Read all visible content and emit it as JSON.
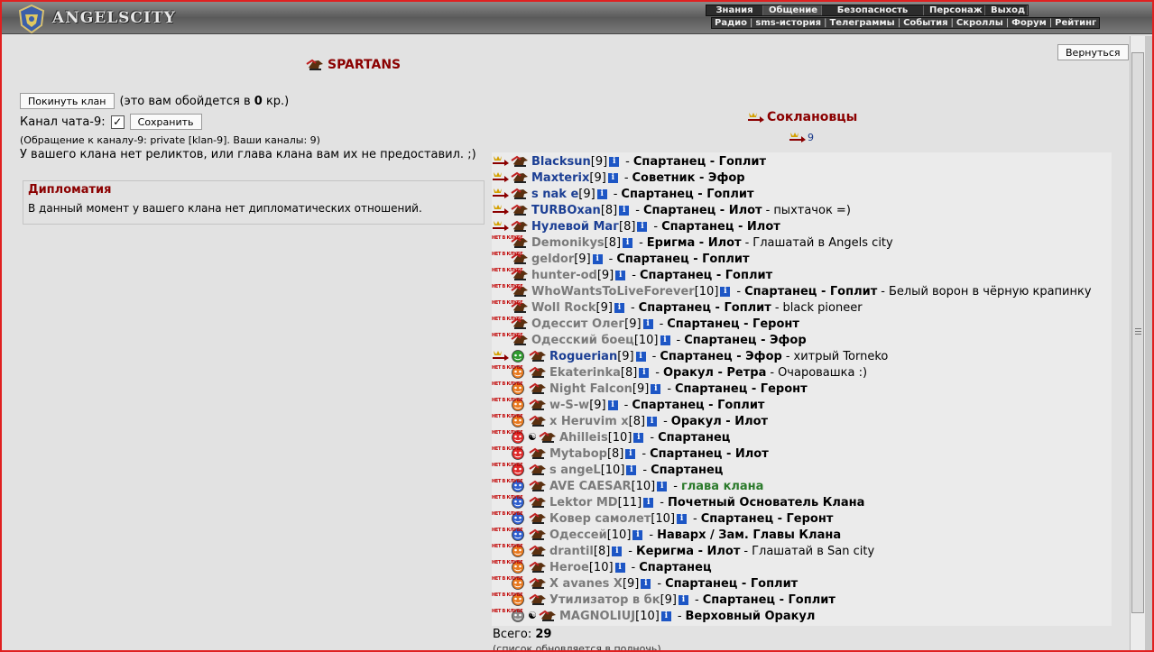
{
  "header": {
    "logo_text": "ANGELSCITY",
    "menu_top": [
      "Знания",
      "Общение",
      "Безопасность",
      "Персонаж",
      "Выход"
    ],
    "menu_top_active": "Общение",
    "menu_sub": [
      "Радио",
      "sms-история",
      "Телеграммы",
      "События",
      "Скроллы",
      "Форум",
      "Рейтинг"
    ]
  },
  "back_button": "Вернуться",
  "clan": {
    "name": "SPARTANS",
    "leave_button": "Покинуть клан",
    "leave_cost_prefix": "(это вам обойдется в ",
    "leave_cost_value": "0",
    "leave_cost_suffix": " кр.)",
    "chat_label": "Канал чата-9:",
    "chat_checked": true,
    "save_button": "Сохранить",
    "chat_note": "(Обращение к каналу-9: private [klan-9]. Ваши каналы: 9)",
    "relic_note": "У вашего клана нет реликтов, или глава клана вам их не предоставил. ;)"
  },
  "diplomacy": {
    "title": "Дипломатия",
    "text": "В данный момент у вашего клана нет дипломатических отношений."
  },
  "members": {
    "title": "Соклановцы",
    "online_count": "9",
    "offline_label": "НЕТ В КЛУБЕ",
    "rows": [
      {
        "online": true,
        "face": null,
        "yinyang": false,
        "indent": false,
        "nick": "Blacksun",
        "lvl": "[9]",
        "role": "Спартанец - Гоплит",
        "note": ""
      },
      {
        "online": true,
        "face": null,
        "yinyang": false,
        "indent": false,
        "nick": "Maxterix",
        "lvl": "[9]",
        "role": "Советник - Эфор",
        "note": ""
      },
      {
        "online": true,
        "face": null,
        "yinyang": false,
        "indent": false,
        "nick": "s nak e",
        "lvl": "[9]",
        "role": "Спартанец - Гоплит",
        "note": ""
      },
      {
        "online": true,
        "face": null,
        "yinyang": false,
        "indent": false,
        "nick": "TURBOxan",
        "lvl": "[8]",
        "role": "Спартанец - Илот",
        "note": "пыхтачок =)"
      },
      {
        "online": true,
        "face": null,
        "yinyang": false,
        "indent": false,
        "nick": "Нулевой Маг",
        "lvl": "[8]",
        "role": "Спартанец - Илот",
        "note": ""
      },
      {
        "online": false,
        "face": null,
        "yinyang": false,
        "indent": false,
        "nick": "Demonikys",
        "lvl": "[8]",
        "role": "Еригма - Илот",
        "note": "Глашатай в Angels city"
      },
      {
        "online": false,
        "face": null,
        "yinyang": false,
        "indent": false,
        "nick": "geldor",
        "lvl": "[9]",
        "role": "Спартанец - Гоплит",
        "note": ""
      },
      {
        "online": false,
        "face": null,
        "yinyang": false,
        "indent": false,
        "nick": "hunter-od",
        "lvl": "[9]",
        "role": "Спартанец - Гоплит",
        "note": ""
      },
      {
        "online": false,
        "face": null,
        "yinyang": false,
        "indent": false,
        "nick": "WhoWantsToLiveForever",
        "lvl": "[10]",
        "role": "Спартанец - Гоплит",
        "note": "Белый ворон в чёрную крапинку"
      },
      {
        "online": false,
        "face": null,
        "yinyang": false,
        "indent": false,
        "nick": "Woll Rock",
        "lvl": "[9]",
        "role": "Спартанец - Гоплит",
        "note": "black pioneer"
      },
      {
        "online": false,
        "face": null,
        "yinyang": false,
        "indent": false,
        "nick": "Одессит Олег",
        "lvl": "[9]",
        "role": "Спартанец - Геронт",
        "note": ""
      },
      {
        "online": false,
        "face": null,
        "yinyang": false,
        "indent": false,
        "nick": "Одесский боец",
        "lvl": "[10]",
        "role": "Спартанец - Эфор",
        "note": ""
      },
      {
        "online": true,
        "face": "green",
        "yinyang": false,
        "indent": true,
        "nick": "Roguerian",
        "lvl": "[9]",
        "role": "Спартанец - Эфор",
        "note": "хитрый Torneko"
      },
      {
        "online": false,
        "face": "orange",
        "yinyang": false,
        "indent": true,
        "nick": "Ekaterinka",
        "lvl": "[8]",
        "role": "Оракул - Ретра",
        "note": "Очаровашка :)"
      },
      {
        "online": false,
        "face": "orange",
        "yinyang": false,
        "indent": true,
        "nick": "Night Falcon",
        "lvl": "[9]",
        "role": "Спартанец - Геронт",
        "note": ""
      },
      {
        "online": false,
        "face": "orange",
        "yinyang": false,
        "indent": true,
        "nick": "w-S-w",
        "lvl": "[9]",
        "role": "Спартанец - Гоплит",
        "note": ""
      },
      {
        "online": false,
        "face": "orange",
        "yinyang": false,
        "indent": true,
        "nick": "x Heruvim x",
        "lvl": "[8]",
        "role": "Оракул - Илот",
        "note": ""
      },
      {
        "online": false,
        "face": "red",
        "yinyang": true,
        "indent": true,
        "nick": "Ahilleis",
        "lvl": "[10]",
        "role": "Спартанец",
        "note": ""
      },
      {
        "online": false,
        "face": "red",
        "yinyang": false,
        "indent": true,
        "nick": "Mytabop",
        "lvl": "[8]",
        "role": "Спартанец - Илот",
        "note": ""
      },
      {
        "online": false,
        "face": "red",
        "yinyang": false,
        "indent": true,
        "nick": "s angeL",
        "lvl": "[10]",
        "role": "Спартанец",
        "note": ""
      },
      {
        "online": false,
        "face": "blue",
        "yinyang": false,
        "indent": true,
        "nick": "AVE CAESAR",
        "lvl": "[10]",
        "role": "глава клана",
        "role_green": true,
        "note": ""
      },
      {
        "online": false,
        "face": "blue",
        "yinyang": false,
        "indent": true,
        "nick": "Lektor MD",
        "lvl": "[11]",
        "role": "Почетный Основатель Клана",
        "note": ""
      },
      {
        "online": false,
        "face": "blue",
        "yinyang": false,
        "indent": true,
        "nick": "Ковер самолет",
        "lvl": "[10]",
        "role": "Спартанец - Геронт",
        "note": ""
      },
      {
        "online": false,
        "face": "blue",
        "yinyang": false,
        "indent": true,
        "nick": "Одессей",
        "lvl": "[10]",
        "role": "Наварх / Зам. Главы Клана",
        "note": ""
      },
      {
        "online": false,
        "face": "orange",
        "yinyang": false,
        "indent": true,
        "nick": "drantil",
        "lvl": "[8]",
        "role": "Керигма - Илот",
        "note": "Глашатай в San city"
      },
      {
        "online": false,
        "face": "orange",
        "yinyang": false,
        "indent": true,
        "nick": "Heroe",
        "lvl": "[10]",
        "role": "Спартанец",
        "note": ""
      },
      {
        "online": false,
        "face": "orange",
        "yinyang": false,
        "indent": true,
        "nick": "X avanes X",
        "lvl": "[9]",
        "role": "Спартанец - Гоплит",
        "note": ""
      },
      {
        "online": false,
        "face": "orange",
        "yinyang": false,
        "indent": true,
        "nick": "Утилизатор в бк",
        "lvl": "[9]",
        "role": "Спартанец - Гоплит",
        "note": ""
      },
      {
        "online": false,
        "face": "gray",
        "yinyang": true,
        "indent": true,
        "nick": "MAGNOLIUJ",
        "lvl": "[10]",
        "role": "Верховный Оракул",
        "note": ""
      }
    ]
  },
  "total_label": "Всего:",
  "total_value": "29",
  "total_note": "(список обновляется в полночь)",
  "colors": {
    "accent_red": "#8b0000",
    "online_nick": "#1c3f94",
    "offline_nick": "#7a7a7a",
    "info_blue": "#1d56c5",
    "leader_green": "#2b7a2b"
  }
}
